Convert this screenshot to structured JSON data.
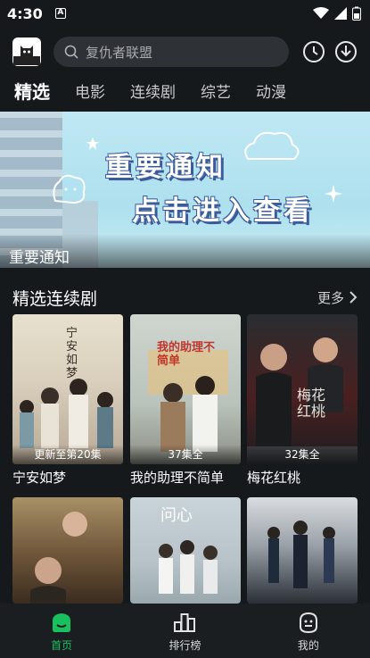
{
  "status_bar": {
    "time": "4:30",
    "notification_letter": "A"
  },
  "header": {
    "search_placeholder": "复仇者联盟"
  },
  "tabs": [
    {
      "label": "精选",
      "active": true
    },
    {
      "label": "电影",
      "active": false
    },
    {
      "label": "连续剧",
      "active": false
    },
    {
      "label": "综艺",
      "active": false
    },
    {
      "label": "动漫",
      "active": false
    }
  ],
  "banner": {
    "line1": "重要通知",
    "line2": "点击进入查看",
    "caption": "重要通知"
  },
  "section": {
    "title": "精选连续剧",
    "more_label": "更多"
  },
  "posters": [
    {
      "title": "宁安如梦",
      "badge": "更新至第20集",
      "art_text": "宁安如梦"
    },
    {
      "title": "我的助理不简单",
      "badge": "37集全",
      "art_text": "我的助理不简单"
    },
    {
      "title": "梅花红桃",
      "badge": "32集全",
      "art_text": "梅花红桃"
    },
    {
      "title": "",
      "badge": "",
      "art_text": ""
    },
    {
      "title": "",
      "badge": "",
      "art_text": "问心"
    },
    {
      "title": "",
      "badge": "",
      "art_text": ""
    }
  ],
  "bottom_nav": [
    {
      "label": "首页",
      "icon": "home-icon",
      "active": true
    },
    {
      "label": "排行榜",
      "icon": "ranking-icon",
      "active": false
    },
    {
      "label": "我的",
      "icon": "profile-icon",
      "active": false
    }
  ],
  "colors": {
    "accent": "#18c15e",
    "background": "#16191c",
    "search_bg": "#2e3236"
  }
}
